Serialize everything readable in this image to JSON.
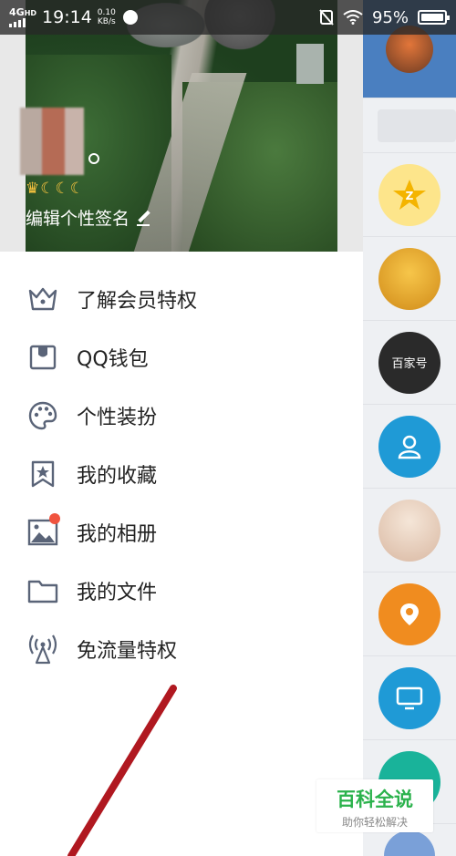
{
  "status_bar": {
    "network": "4G",
    "network_sub": "HD",
    "time": "19:14",
    "speed_value": "0.10",
    "speed_unit": "KB/s",
    "battery": "95%"
  },
  "profile": {
    "level_badges": "♛☾☾☾",
    "edit_signature": "编辑个性签名"
  },
  "menu": {
    "items": [
      {
        "label": "了解会员特权",
        "icon": "crown-icon"
      },
      {
        "label": "QQ钱包",
        "icon": "wallet-icon"
      },
      {
        "label": "个性装扮",
        "icon": "palette-icon"
      },
      {
        "label": "我的收藏",
        "icon": "bookmark-star-icon"
      },
      {
        "label": "我的相册",
        "icon": "photo-album-icon",
        "badge": true
      },
      {
        "label": "我的文件",
        "icon": "folder-icon"
      },
      {
        "label": "免流量特权",
        "icon": "antenna-icon"
      }
    ]
  },
  "right_strip": {
    "app_text": "百家号"
  },
  "watermark": {
    "title": "百科全说",
    "subtitle": "助你轻松解决"
  },
  "colors": {
    "icon_gray": "#5a6478",
    "badge_red": "#f0533e",
    "annotation_red": "#b01820",
    "watermark_green": "#2bb24c"
  }
}
